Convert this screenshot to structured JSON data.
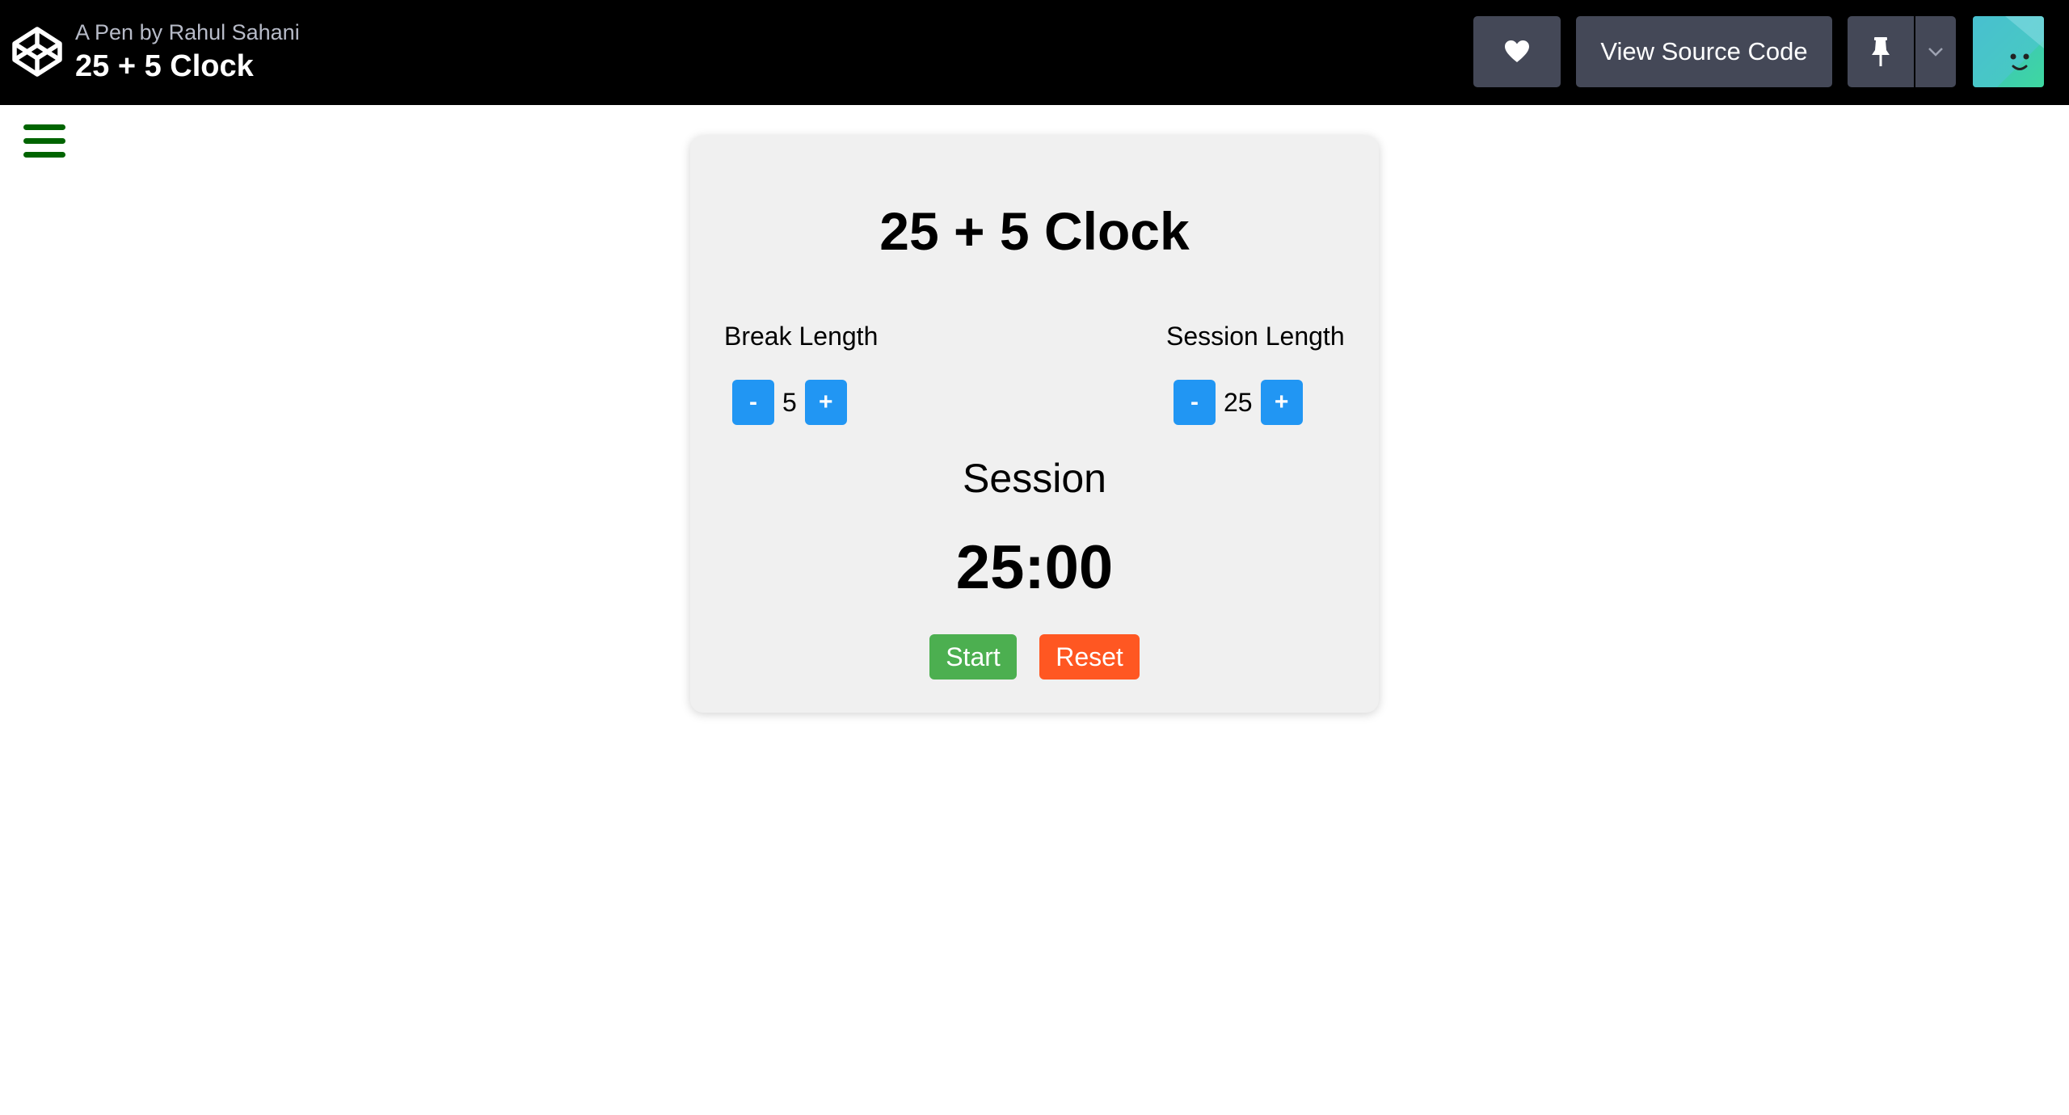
{
  "header": {
    "byline": "A Pen by Rahul Sahani",
    "title": "25 + 5 Clock",
    "logo_icon": "codepen-logo-icon",
    "heart_icon": "heart-icon",
    "view_source_label": "View Source Code",
    "pin_icon": "pin-icon",
    "pin_menu_icon": "chevron-down-icon",
    "avatar_icon": "user-avatar"
  },
  "sidebar_toggle": {
    "icon": "hamburger-menu-icon",
    "color": "#006400"
  },
  "clock": {
    "title": "25 + 5 Clock",
    "break": {
      "label": "Break Length",
      "decrement": "-",
      "value": "5",
      "increment": "+"
    },
    "session": {
      "label": "Session Length",
      "decrement": "-",
      "value": "25",
      "increment": "+"
    },
    "timer_label": "Session",
    "time_left": "25:00",
    "start_label": "Start",
    "reset_label": "Reset"
  },
  "colors": {
    "header_bg": "#000000",
    "header_button_bg": "#444857",
    "card_bg": "#f0f0f0",
    "step_button": "#2196f3",
    "start_button": "#4caf50",
    "reset_button": "#ff5722"
  }
}
